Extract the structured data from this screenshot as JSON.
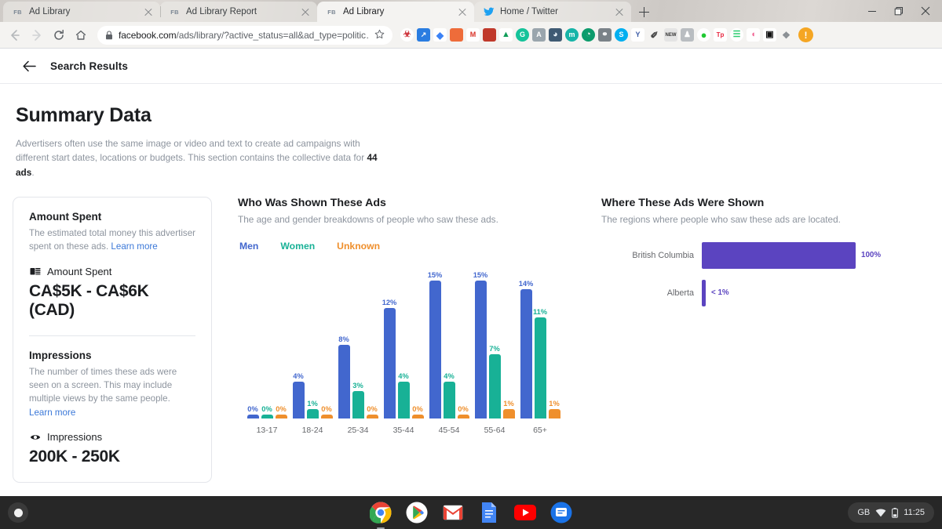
{
  "browser": {
    "tabs": [
      {
        "title": "Ad Library",
        "favicon": "facebook-icon",
        "active": false
      },
      {
        "title": "Ad Library Report",
        "favicon": "facebook-icon",
        "active": false
      },
      {
        "title": "Ad Library",
        "favicon": "facebook-icon",
        "active": true
      },
      {
        "title": "Home / Twitter",
        "favicon": "twitter-icon",
        "active": false
      }
    ],
    "new_tab_label": "+",
    "url_domain": "facebook.com",
    "url_path": "/ads/library/?active_status=all&ad_type=politic…",
    "nav": {
      "back": "back-icon",
      "forward": "forward-icon",
      "reload": "reload-icon",
      "home": "home-icon"
    },
    "extensions": [
      {
        "name": "honey-extension",
        "glyph": "U",
        "bg": "#cc2b33"
      },
      {
        "name": "diagonal-arrow-extension",
        "glyph": "↗",
        "bg": "#2a7de1"
      },
      {
        "name": "diamond-extension",
        "glyph": "◆",
        "bg": "#ffffff",
        "fg": "#3b82f6"
      },
      {
        "name": "notebook-extension",
        "glyph": "▌",
        "bg": "#ee6c3a"
      },
      {
        "name": "gmail-extension",
        "glyph": "M",
        "bg": "#ffffff",
        "fg": "#d93025"
      },
      {
        "name": "book-extension",
        "glyph": "▌",
        "bg": "#c0392b"
      },
      {
        "name": "google-drive-extension",
        "glyph": "▲",
        "bg": "#ffffff",
        "fg": "#0f9d58"
      },
      {
        "name": "grammarly-extension",
        "glyph": "G",
        "bg": "#15c39a"
      },
      {
        "name": "printer-extension",
        "glyph": "A",
        "bg": "#9aa5ad"
      },
      {
        "name": "moon-extension",
        "glyph": "◑",
        "bg": "#3f5a73"
      },
      {
        "name": "circle-m-extension",
        "glyph": "m",
        "bg": "#17b4a8"
      },
      {
        "name": "clock-extension",
        "glyph": "◔",
        "bg": "#0d9b6c"
      },
      {
        "name": "shield-extension",
        "glyph": "⛉",
        "bg": "#7a8288"
      },
      {
        "name": "skype-extension",
        "glyph": "S",
        "bg": "#00aff0"
      },
      {
        "name": "yandex-extension",
        "glyph": "Y",
        "bg": "#ffffff",
        "fg": "#3b5ba5"
      },
      {
        "name": "eyedropper-extension",
        "glyph": "✐",
        "bg": "#ffffff",
        "fg": "#444"
      },
      {
        "name": "new-badge-extension",
        "glyph": "N",
        "bg": "#e8e8e8",
        "fg": "#333"
      },
      {
        "name": "person-extension",
        "glyph": "♟",
        "bg": "#b9bdc1"
      },
      {
        "name": "green-drop-extension",
        "glyph": "●",
        "bg": "#20c933"
      },
      {
        "name": "tp-extension",
        "glyph": "Tp",
        "bg": "#ffffff",
        "fg": "#e8253e"
      },
      {
        "name": "pill-extension",
        "glyph": "≡",
        "bg": "#2ecc71"
      },
      {
        "name": "speaker-extension",
        "glyph": "◖",
        "bg": "#ffffff",
        "fg": "#f06292"
      },
      {
        "name": "picture-in-picture-extension",
        "glyph": "▣",
        "bg": "#ffffff",
        "fg": "#111"
      },
      {
        "name": "puzzle-extension",
        "glyph": "❖",
        "bg": "#ffffff",
        "fg": "#8a8f94"
      }
    ],
    "profile_avatar": "!",
    "window_controls": {
      "minimize": "minimize-icon",
      "maximize": "maximize-icon",
      "close": "close-icon"
    }
  },
  "page": {
    "header_title": "Search Results",
    "h1": "Summary Data",
    "subtitle_part1": "Advertisers often use the same image or video and text to create ad campaigns with different start dates, locations or budgets. This section contains the collective data for ",
    "subtitle_bold": "44 ads",
    "subtitle_part2": "."
  },
  "amount_card": {
    "spend": {
      "title": "Amount Spent",
      "description": "The estimated total money this advertiser spent on these ads. ",
      "learn_more": "Learn more",
      "metric_label": "Amount Spent",
      "metric_value": "CA$5K - CA$6K (CAD)",
      "icon": "money-stack-icon"
    },
    "impressions": {
      "title": "Impressions",
      "description": "The number of times these ads were seen on a screen. This may include multiple views by the same people. ",
      "learn_more": "Learn more",
      "metric_label": "Impressions",
      "metric_value": "200K - 250K",
      "icon": "eye-icon"
    }
  },
  "demographics": {
    "title": "Who Was Shown These Ads",
    "subtitle": "The age and gender breakdowns of people who saw these ads."
  },
  "regions": {
    "title": "Where These Ads Were Shown",
    "subtitle": "The regions where people who saw these ads are located."
  },
  "chart_data": [
    {
      "type": "bar",
      "title": "Who Was Shown These Ads",
      "subtitle": "The age and gender breakdowns of people who saw these ads.",
      "xlabel": "",
      "ylabel": "",
      "ylim": [
        0,
        16
      ],
      "grid": false,
      "legend_position": "top-left",
      "categories": [
        "13-17",
        "18-24",
        "25-34",
        "35-44",
        "45-54",
        "55-64",
        "65+"
      ],
      "series": [
        {
          "name": "Men",
          "color": "#4267ce",
          "values": [
            0,
            4,
            8,
            12,
            15,
            15,
            14
          ],
          "labels": [
            "0%",
            "4%",
            "8%",
            "12%",
            "15%",
            "15%",
            "14%"
          ]
        },
        {
          "name": "Women",
          "color": "#18b196",
          "values": [
            0,
            1,
            3,
            4,
            4,
            7,
            11
          ],
          "labels": [
            "0%",
            "1%",
            "3%",
            "4%",
            "4%",
            "7%",
            "11%"
          ]
        },
        {
          "name": "Unknown",
          "color": "#ef8f2c",
          "values": [
            0,
            0,
            0,
            0,
            0,
            1,
            1
          ],
          "labels": [
            "0%",
            "0%",
            "0%",
            "0%",
            "0%",
            "1%",
            "1%"
          ]
        }
      ]
    },
    {
      "type": "bar",
      "orientation": "horizontal",
      "title": "Where These Ads Were Shown",
      "subtitle": "The regions where people who saw these ads are located.",
      "xlabel": "",
      "ylabel": "",
      "xlim": [
        0,
        100
      ],
      "grid": false,
      "color": "#5b44c0",
      "categories": [
        "British Columbia",
        "Alberta"
      ],
      "values": [
        100,
        0.4
      ],
      "labels": [
        "100%",
        "< 1%"
      ]
    }
  ],
  "shelf": {
    "launcher": "launcher-icon",
    "apps": [
      {
        "name": "chrome-app",
        "active": true
      },
      {
        "name": "play-store-app",
        "active": false
      },
      {
        "name": "gmail-app",
        "active": false
      },
      {
        "name": "docs-app",
        "active": false
      },
      {
        "name": "youtube-app",
        "active": false
      },
      {
        "name": "messages-app",
        "active": false
      }
    ],
    "tray": {
      "locale": "GB",
      "wifi": "wifi-icon",
      "battery": "battery-icon",
      "time": "11:25"
    }
  }
}
